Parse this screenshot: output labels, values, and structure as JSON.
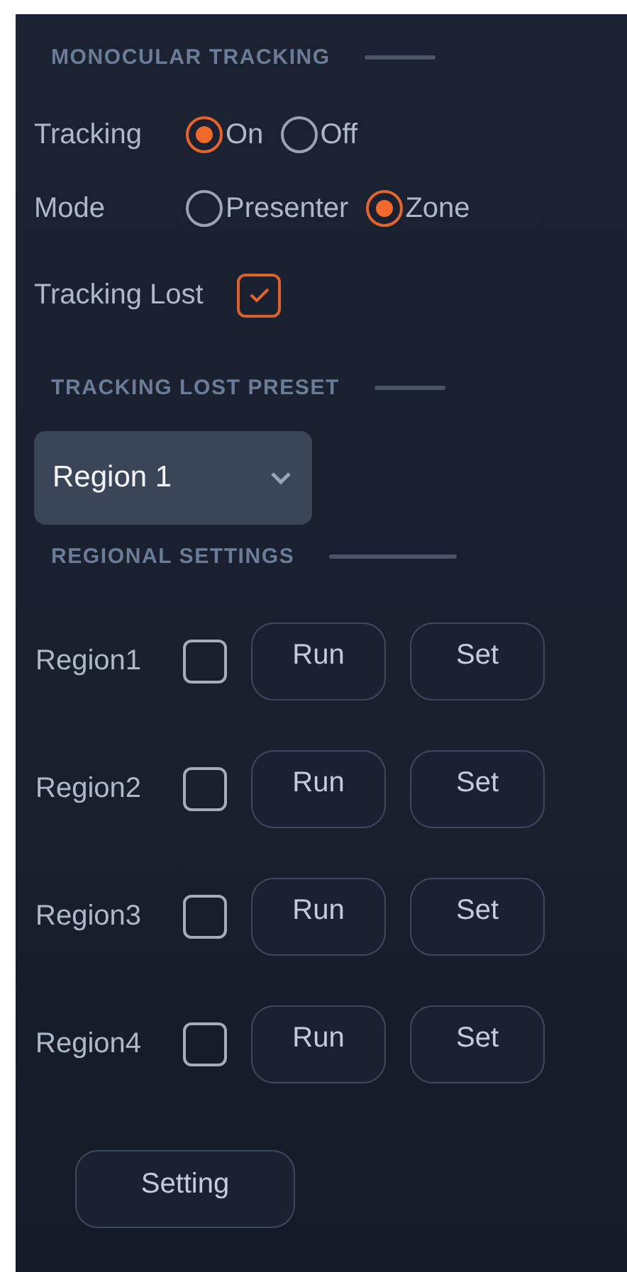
{
  "sections": [
    {
      "title": "MONOCULAR TRACKING"
    },
    {
      "title": "TRACKING LOST PRESET"
    },
    {
      "title": "REGIONAL SETTINGS"
    }
  ],
  "tracking": {
    "label": "Tracking",
    "options": [
      {
        "label": "On",
        "selected": true
      },
      {
        "label": "Off",
        "selected": false
      }
    ]
  },
  "mode": {
    "label": "Mode",
    "options": [
      {
        "label": "Presenter",
        "selected": false
      },
      {
        "label": "Zone",
        "selected": true
      }
    ]
  },
  "tracking_lost": {
    "label": "Tracking Lost",
    "checked": true
  },
  "preset": {
    "value": "Region 1"
  },
  "regions": [
    {
      "label": "Region1",
      "checked": false,
      "buttons": [
        "Run",
        "Set"
      ]
    },
    {
      "label": "Region2",
      "checked": false,
      "buttons": [
        "Run",
        "Set"
      ]
    },
    {
      "label": "Region3",
      "checked": false,
      "buttons": [
        "Run",
        "Set"
      ]
    },
    {
      "label": "Region4",
      "checked": false,
      "buttons": [
        "Run",
        "Set"
      ]
    }
  ],
  "setting_button": "Setting"
}
